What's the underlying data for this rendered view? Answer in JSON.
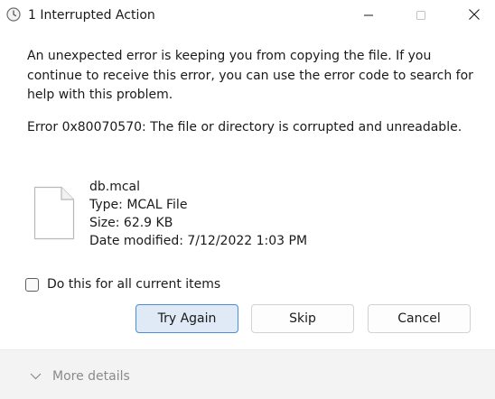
{
  "window": {
    "title": "1 Interrupted Action"
  },
  "message": {
    "body": "An unexpected error is keeping you from copying the file. If you continue to receive this error, you can use the error code to search for help with this problem.",
    "error": "Error 0x80070570: The file or directory is corrupted and unreadable."
  },
  "file": {
    "name": "db.mcal",
    "type": "Type: MCAL File",
    "size": "Size: 62.9 KB",
    "modified": "Date modified: 7/12/2022 1:03 PM",
    "icon": "document-icon"
  },
  "options": {
    "apply_all_label": "Do this for all current items",
    "apply_all_checked": false
  },
  "buttons": {
    "try_again": "Try Again",
    "skip": "Skip",
    "cancel": "Cancel"
  },
  "footer": {
    "more_details": "More details"
  },
  "colors": {
    "accent_border": "#4a8fd6",
    "accent_fill": "#e0eaf6",
    "footer_bg": "#f3f3f3"
  }
}
